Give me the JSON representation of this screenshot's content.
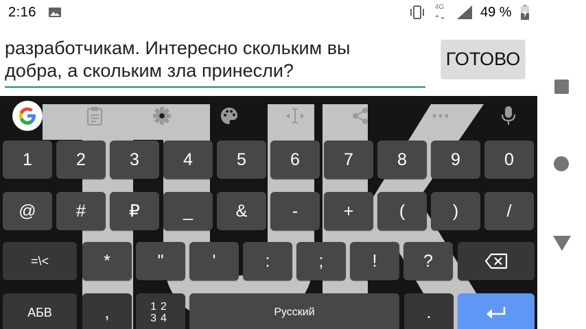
{
  "status_bar": {
    "time": "2:16",
    "network": "4G",
    "battery": "49 %",
    "icons": [
      "image-notification-icon",
      "vibrate-icon",
      "network-4g-icon",
      "signal-icon",
      "battery-icon"
    ]
  },
  "input": {
    "text": "разработчикам. Интересно скольким вы\nдобра, а скольким зла принесли?",
    "done_label": "ГОТОВО",
    "underline_color": "#1b8a7a"
  },
  "toolbar": {
    "icons": [
      "google-icon",
      "clipboard-icon",
      "settings-icon",
      "palette-icon",
      "text-cursor-icon",
      "share-icon",
      "more-icon",
      "mic-icon"
    ]
  },
  "keyboard": {
    "row1": [
      "1",
      "2",
      "3",
      "4",
      "5",
      "6",
      "7",
      "8",
      "9",
      "0"
    ],
    "row2": [
      "@",
      "#",
      "₽",
      "_",
      "&",
      "-",
      "+",
      "(",
      ")",
      "/"
    ],
    "row3": {
      "fn_label": "=\\<",
      "keys": [
        "*",
        "\"",
        "'",
        ":",
        ";",
        "!",
        "?"
      ],
      "backspace_icon": "backspace-icon"
    },
    "row4": {
      "abc_label": "АБВ",
      "comma": ",",
      "numpad_top": "12",
      "numpad_bottom": "34",
      "space_label": "Русский",
      "period": ".",
      "enter_icon": "enter-icon"
    },
    "colors": {
      "key": "#474747",
      "fn_key": "#373737",
      "enter": "#5e97f6",
      "background": "#151515"
    }
  },
  "nav_bar": {
    "icons": [
      "recent-apps-icon",
      "home-icon",
      "back-icon"
    ]
  }
}
